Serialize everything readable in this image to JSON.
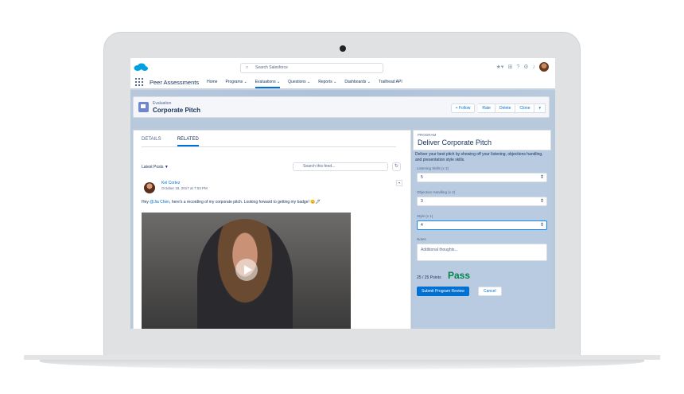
{
  "topbar": {
    "search_placeholder": "Search Salesforce"
  },
  "nav": {
    "app_name": "Peer Assessments",
    "items": [
      "Home",
      "Programs ⌄",
      "Evaluations ⌄",
      "Questions ⌄",
      "Reports ⌄",
      "Dashboards ⌄",
      "Trailhead API"
    ],
    "active": "Evaluations"
  },
  "header": {
    "type": "Evaluation",
    "name": "Corporate Pitch",
    "buttons": {
      "follow": "+ Follow",
      "rate": "Rate",
      "delete": "Delete",
      "clone": "Clone"
    }
  },
  "tabs": {
    "details": "DETAILS",
    "related": "RELATED"
  },
  "feed": {
    "filter": "Latest Posts ▼",
    "search_placeholder": "Search this feed...",
    "post": {
      "author": "Kel Cortez",
      "date": "October 18, 2017 at 7:03 PM",
      "text_prefix": "Hey ",
      "mention": "@Jia Chen",
      "text_suffix": ", here's a recording of my corporate pitch. Looking forward to getting my badge! 😊🖋"
    }
  },
  "program": {
    "label": "PROGRAM",
    "title": "Deliver Corporate Pitch",
    "description": "Deliver your best pitch by showing off your listening, objections handling, and presentation style skills.",
    "fields": [
      {
        "label": "Listening Skills (x 3)",
        "value": "5"
      },
      {
        "label": "Objection Handling (x 2)",
        "value": "3"
      },
      {
        "label": "Style (x 1)",
        "value": "4"
      }
    ],
    "notes_label": "Notes",
    "notes_placeholder": "Additional thoughts...",
    "points": "25 / 25 Points",
    "result": "Pass",
    "submit": "Submit Program Review",
    "cancel": "Cancel"
  },
  "colors": {
    "brand": "#0070d2",
    "pass": "#04844b",
    "panel": "#b8cbe1"
  }
}
